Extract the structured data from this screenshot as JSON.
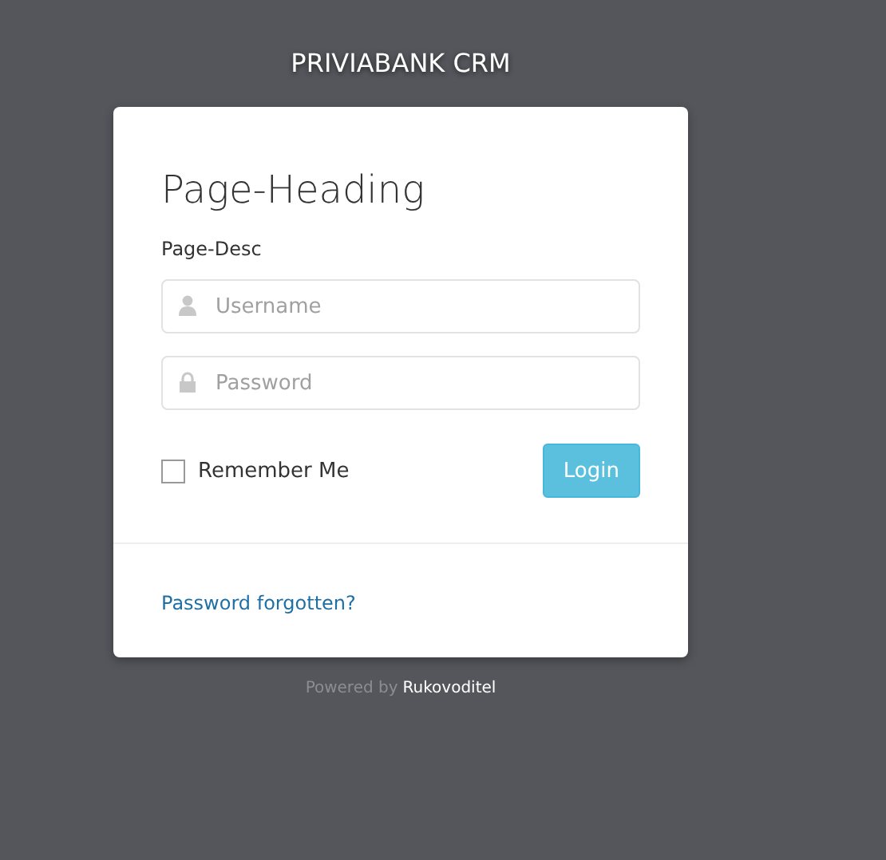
{
  "app_title": "PRIVIABANK CRM",
  "card": {
    "heading": "Page-Heading",
    "description": "Page-Desc",
    "fields": [
      {
        "kind": "user",
        "placeholder": "Username"
      },
      {
        "kind": "lock",
        "placeholder": "Password"
      }
    ],
    "remember": {
      "label": "Remember Me",
      "checked": false
    },
    "login_button": "Login",
    "forgot_link": "Password forgotten?"
  },
  "footer": {
    "prefix": "Powered by",
    "link": "Rukovoditel"
  }
}
